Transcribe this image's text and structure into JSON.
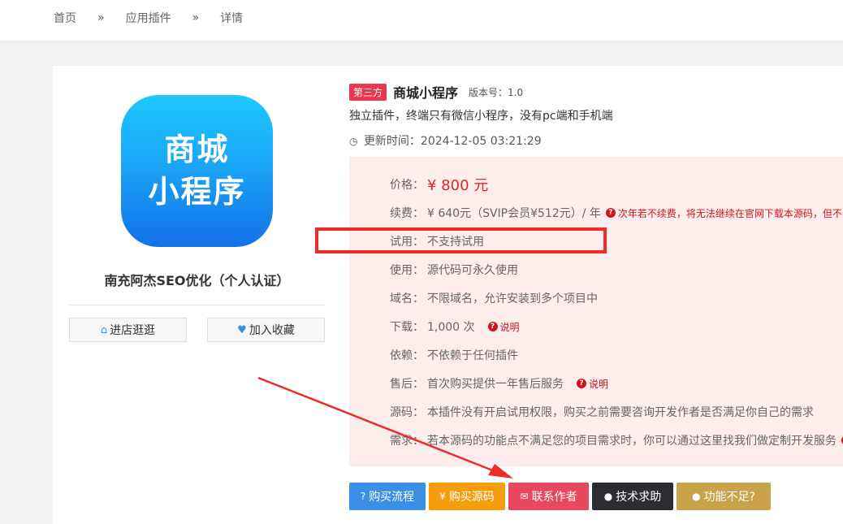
{
  "breadcrumb": {
    "home": "首页",
    "sep": "»",
    "plugins": "应用插件",
    "detail": "详情"
  },
  "logo": {
    "line1": "商城",
    "line2": "小程序"
  },
  "author": "南充阿杰SEO优化（个人认证）",
  "side_buttons": {
    "shop": "进店逛逛",
    "favorite": "加入收藏"
  },
  "product": {
    "badge": "第三方",
    "title": "商城小程序",
    "version": "版本号：1.0",
    "description": "独立插件，终端只有微信小程序，没有pc端和手机端",
    "updated": "更新时间：2024-12-05 03:21:29"
  },
  "details": {
    "price_label": "价格：",
    "price_value": "¥ 800 元",
    "renew_label": "续费：",
    "renew_value": "¥ 640元（SVIP会员¥512元）/ 年",
    "renew_warning": "次年若不续费，将无法继续在官网下载本源码，但不影",
    "trial_label": "试用：",
    "trial_value": "不支持试用",
    "use_label": "使用：",
    "use_value": "源代码可永久使用",
    "domain_label": "域名：",
    "domain_value": "不限域名，允许安装到多个项目中",
    "download_label": "下载：",
    "download_value": "1,000 次",
    "download_explain": "说明",
    "depend_label": "依赖：",
    "depend_value": "不依赖于任何插件",
    "aftersale_label": "售后：",
    "aftersale_value": "首次购买提供一年售后服务",
    "aftersale_explain": "说明",
    "source_label": "源码：",
    "source_value": "本插件没有开启试用权限，购买之前需要咨询开发作者是否满足你自己的需求",
    "need_label": "需求：",
    "need_value": "若本源码的功能点不满足您的项目需求时，你可以通过这里找我们做定制开发服务"
  },
  "actions": {
    "process": "购买流程",
    "buy": "购买源码",
    "contact": "联系作者",
    "support": "技术求助",
    "lacking": "功能不足?"
  },
  "colors": {
    "accent_red": "#e0242f",
    "annotation": "#ec2b2b",
    "logo_blue": "#1aa6f7"
  }
}
